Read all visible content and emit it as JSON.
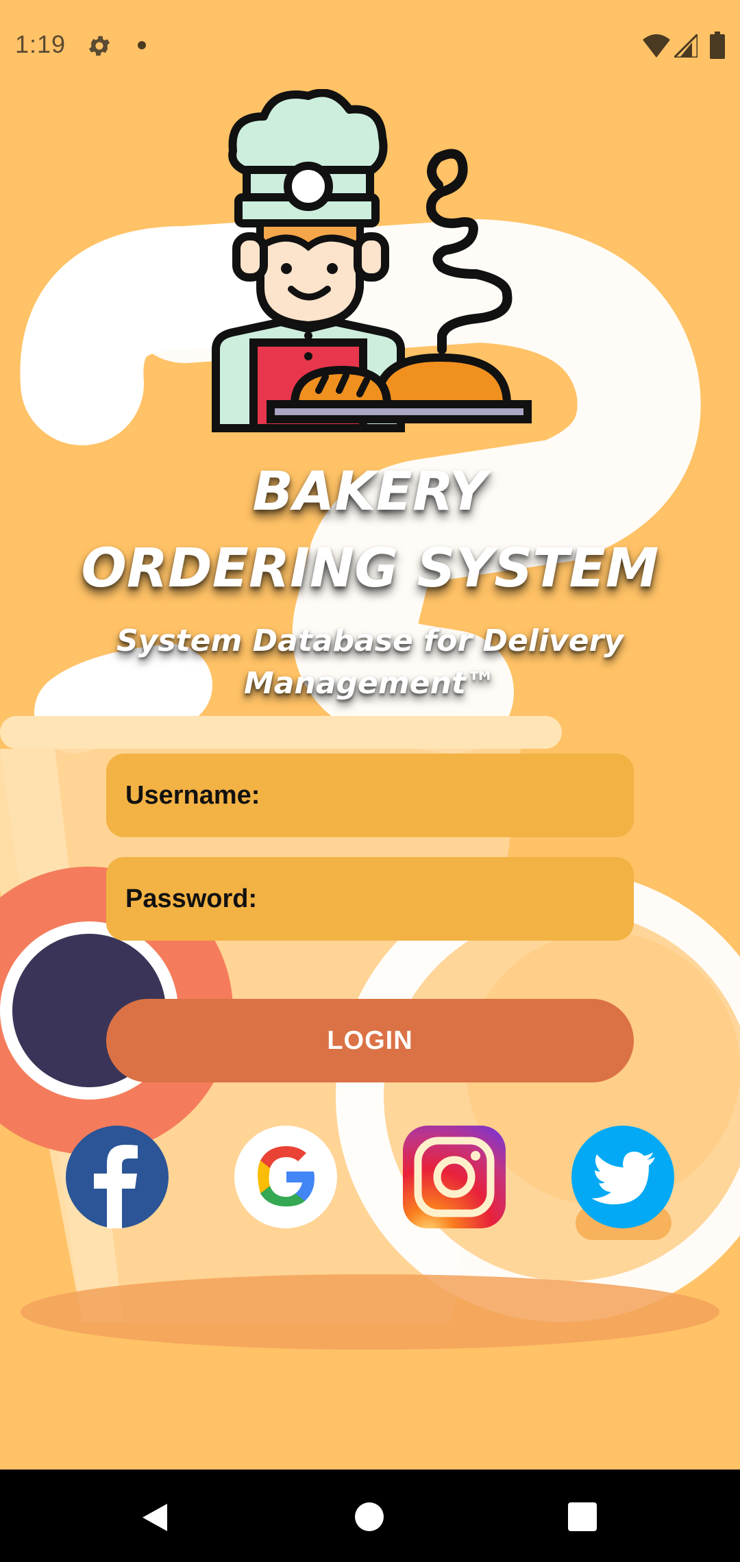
{
  "status_bar": {
    "time": "1:19",
    "icons": [
      "gear-icon",
      "notification-dot-icon",
      "wifi-icon",
      "cell-signal-icon",
      "battery-icon"
    ]
  },
  "app": {
    "title_line_1": "BAKERY",
    "title_line_2": "ORDERING SYSTEM",
    "subtitle_line_1": "System Database for Delivery",
    "subtitle_line_2": "Management™",
    "logo_icon": "chef-with-bread-icon"
  },
  "form": {
    "username_label": "Username:",
    "username_value": "",
    "password_label": "Password:",
    "password_value": "",
    "login_label": "LOGIN"
  },
  "social": {
    "icons": [
      "facebook-icon",
      "google-icon",
      "instagram-icon",
      "twitter-icon"
    ]
  },
  "nav_bar": {
    "icons": [
      "back-icon",
      "home-icon",
      "recents-icon"
    ]
  },
  "colors": {
    "background": "#FFC266",
    "field": "#F2B244",
    "login_button": "#DB7245",
    "facebook": "#2B5597",
    "twitter": "#03A9F4"
  }
}
